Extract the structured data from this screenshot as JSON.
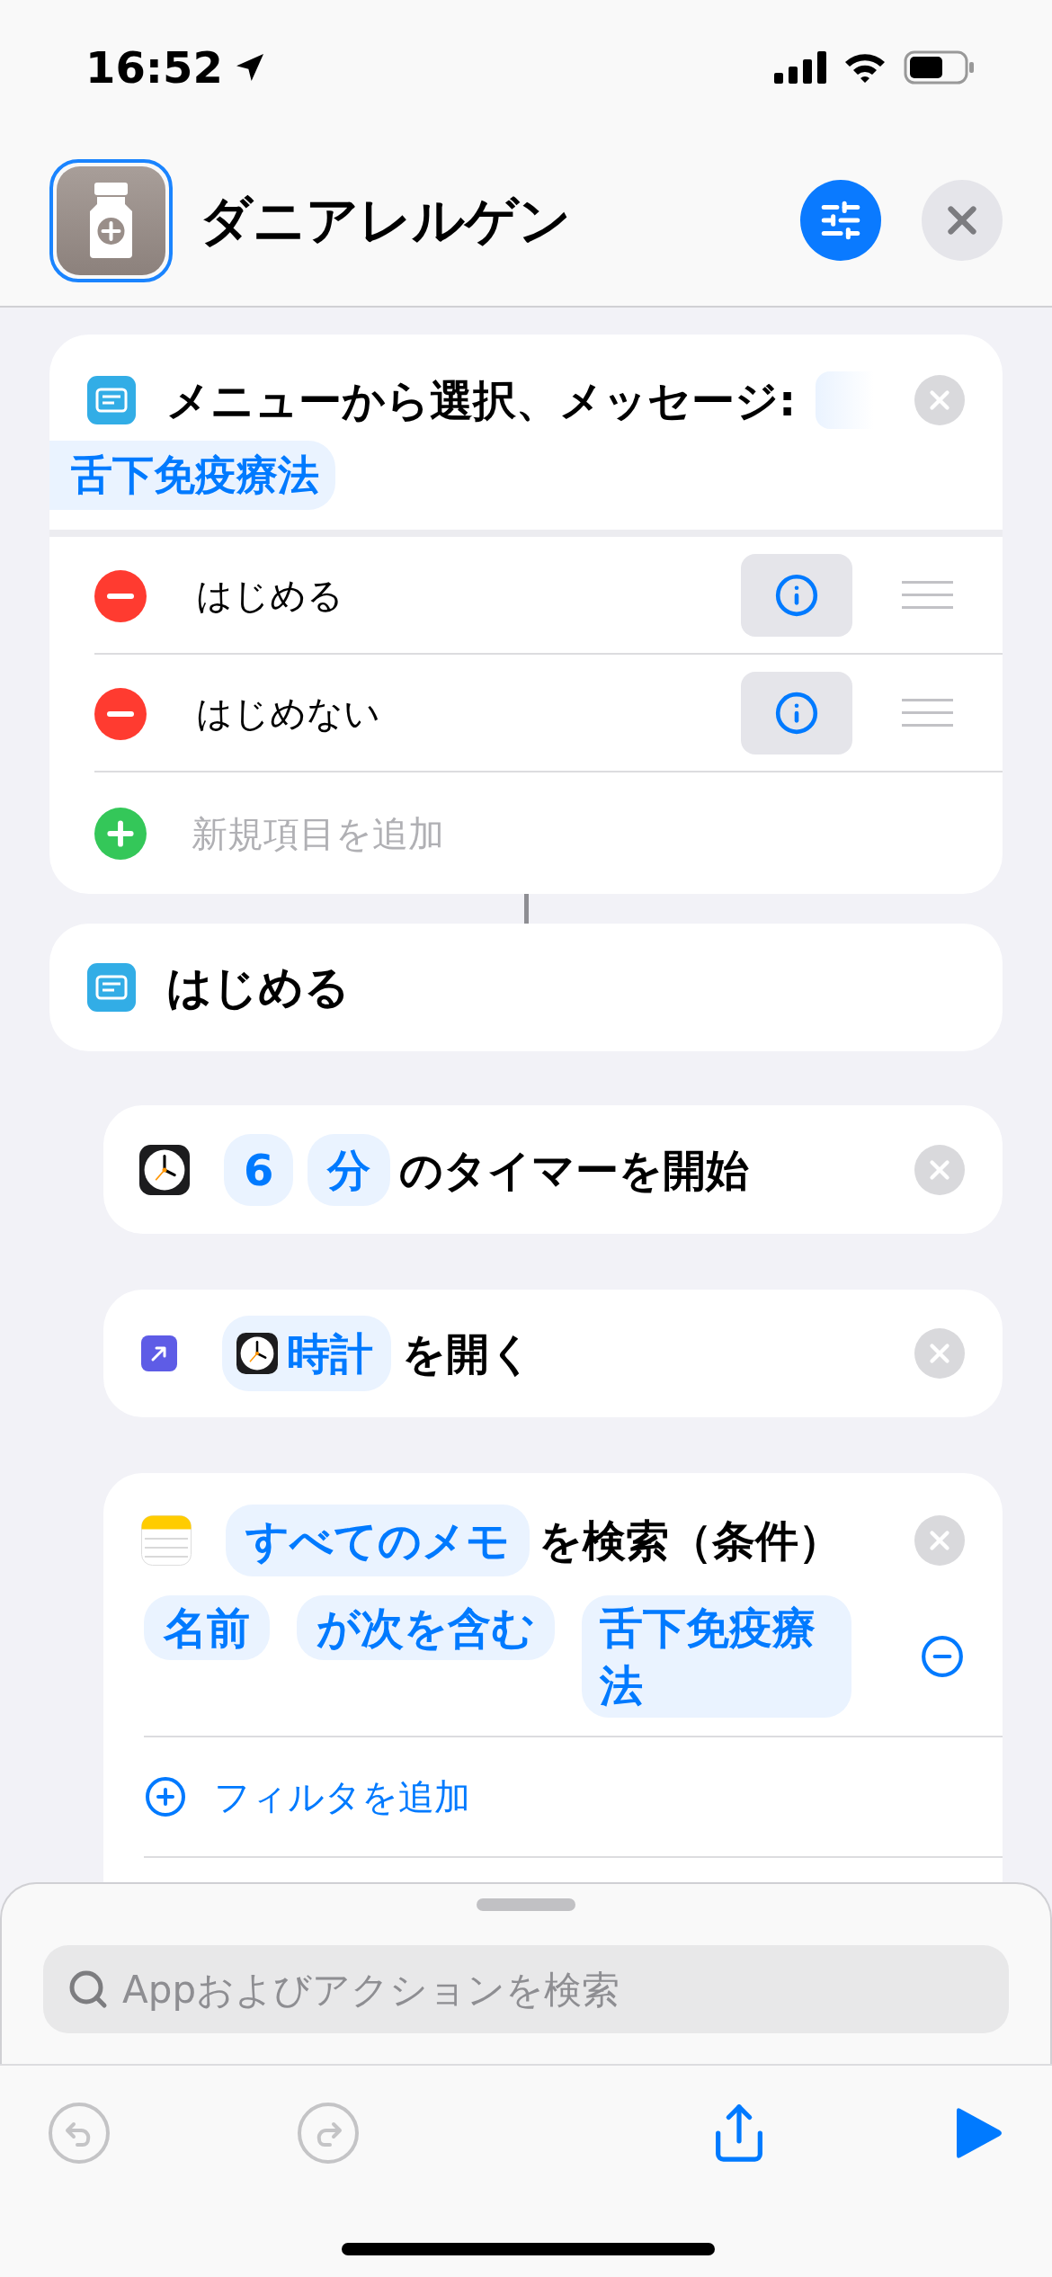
{
  "status_bar": {
    "time": "16:52"
  },
  "header": {
    "title": "ダニアレルゲン"
  },
  "menu_action": {
    "title": "メニューから選択、メッセージ:",
    "message": "舌下免疫療法",
    "items": [
      {
        "label": "はじめる"
      },
      {
        "label": "はじめない"
      }
    ],
    "add_item": "新規項目を追加"
  },
  "menu_case": {
    "title": "はじめる"
  },
  "timer_action": {
    "amount": "6",
    "unit": "分",
    "text": "のタイマーを開始"
  },
  "open_app_action": {
    "app": "時計",
    "text": "を開く"
  },
  "find_notes_action": {
    "source": "すべてのメモ",
    "text": "を検索（条件）",
    "filter": {
      "field": "名前",
      "operator": "が次を含む",
      "value": "舌下免疫療法"
    },
    "add_filter": "フィルタを追加"
  },
  "search": {
    "placeholder": "Appおよびアクションを検索"
  },
  "toolbar": {
    "undo": {
      "disabled": true
    },
    "redo": {
      "disabled": true
    }
  }
}
